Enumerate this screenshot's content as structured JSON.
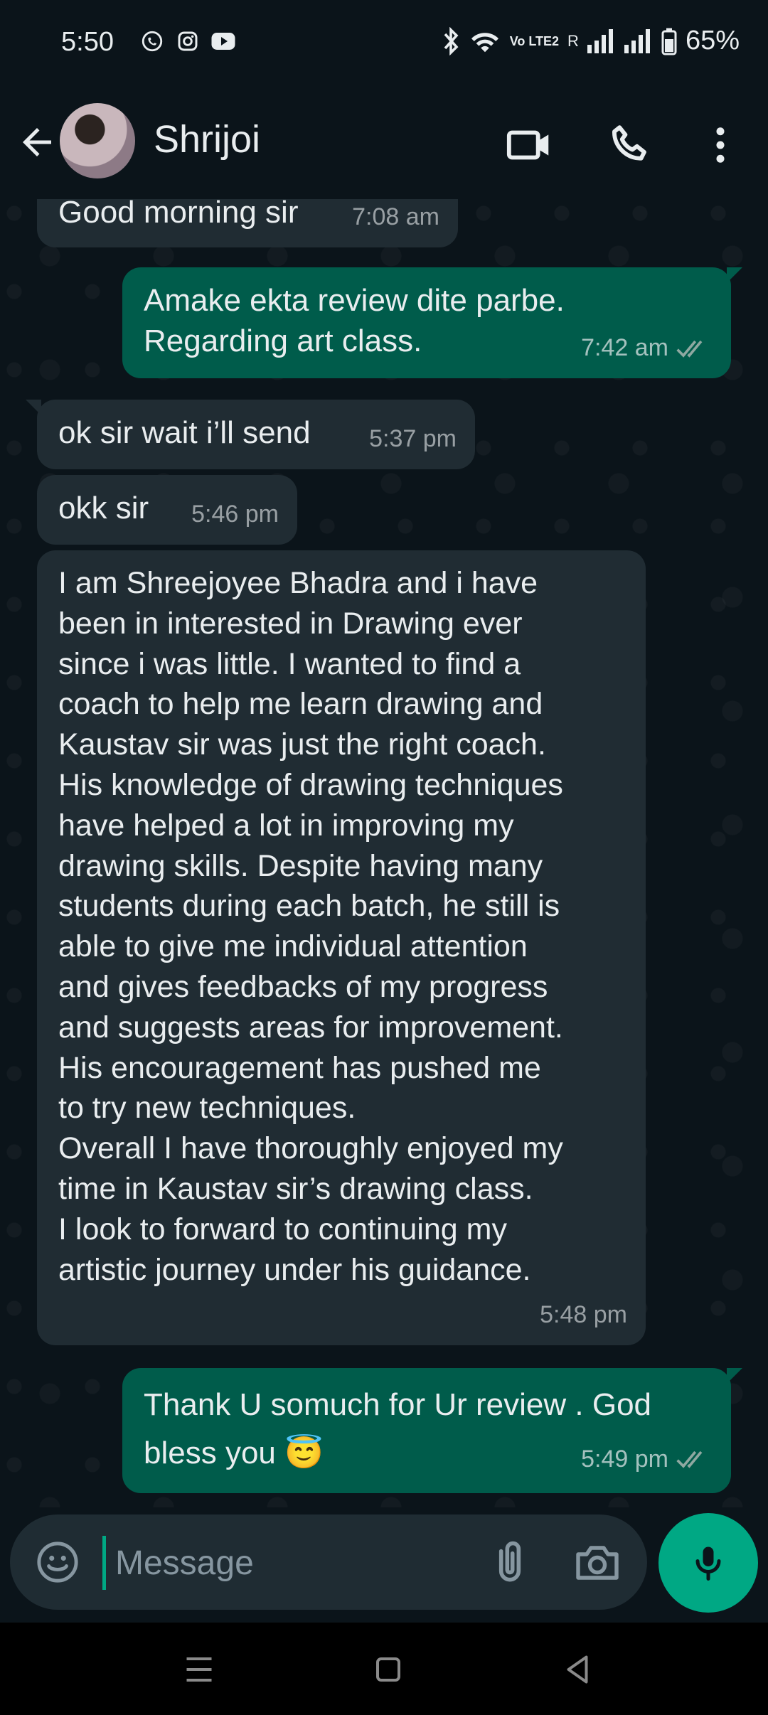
{
  "status_bar": {
    "time": "5:50",
    "battery": "65%",
    "left_icons": [
      "whatsapp-icon",
      "instagram-icon",
      "youtube-icon"
    ],
    "right_icons": [
      "bluetooth-icon",
      "wifi-icon",
      "volte-icon",
      "signal-icon",
      "signal-icon",
      "battery-icon"
    ],
    "volte_label": "Vo LTE2",
    "roaming_label": "R"
  },
  "header": {
    "contact_name": "Shrijoi",
    "icons": [
      "back-arrow-icon",
      "video-call-icon",
      "voice-call-icon",
      "more-options-icon"
    ]
  },
  "messages": [
    {
      "direction": "in",
      "text": "Good morning sir",
      "time": "7:08 am"
    },
    {
      "direction": "out",
      "text": "Amake ekta review dite parbe.\nRegarding art class.",
      "time": "7:42 am",
      "status": "read"
    },
    {
      "direction": "in",
      "text": "ok sir wait i’ll send",
      "time": "5:37 pm"
    },
    {
      "direction": "in",
      "text": "okk sir",
      "time": "5:46 pm"
    },
    {
      "direction": "in",
      "text": "I am Shreejoyee Bhadra and i have\nbeen in interested in Drawing ever\nsince i was little. I wanted to find a\ncoach to help me learn drawing and\nKaustav sir was just the right coach.\nHis knowledge of drawing techniques\nhave helped a lot in improving my\ndrawing skills. Despite having many\nstudents during each batch, he still is\nable to give me individual attention\nand gives feedbacks of my progress\nand suggests areas for improvement.\nHis encouragement has pushed me\nto try new techniques.\nOverall I have thoroughly enjoyed my\ntime in Kaustav sir’s drawing class.\nI look to forward to continuing my\nartistic journey under his guidance.",
      "time": "5:48 pm"
    },
    {
      "direction": "out",
      "text": "Thank U somuch for Ur review . God\nbless you 😇",
      "time": "5:49 pm",
      "status": "read"
    }
  ],
  "composer": {
    "placeholder": "Message",
    "icons": [
      "emoji-icon",
      "attach-icon",
      "camera-icon",
      "mic-icon"
    ]
  },
  "nav_bar": {
    "icons": [
      "menu-icon",
      "home-icon",
      "back-icon"
    ]
  },
  "colors": {
    "background": "#0b141a",
    "incoming_bubble": "#202c33",
    "outgoing_bubble": "#005c4b",
    "accent": "#00a884",
    "read_ticks": "#8fa8a1"
  }
}
